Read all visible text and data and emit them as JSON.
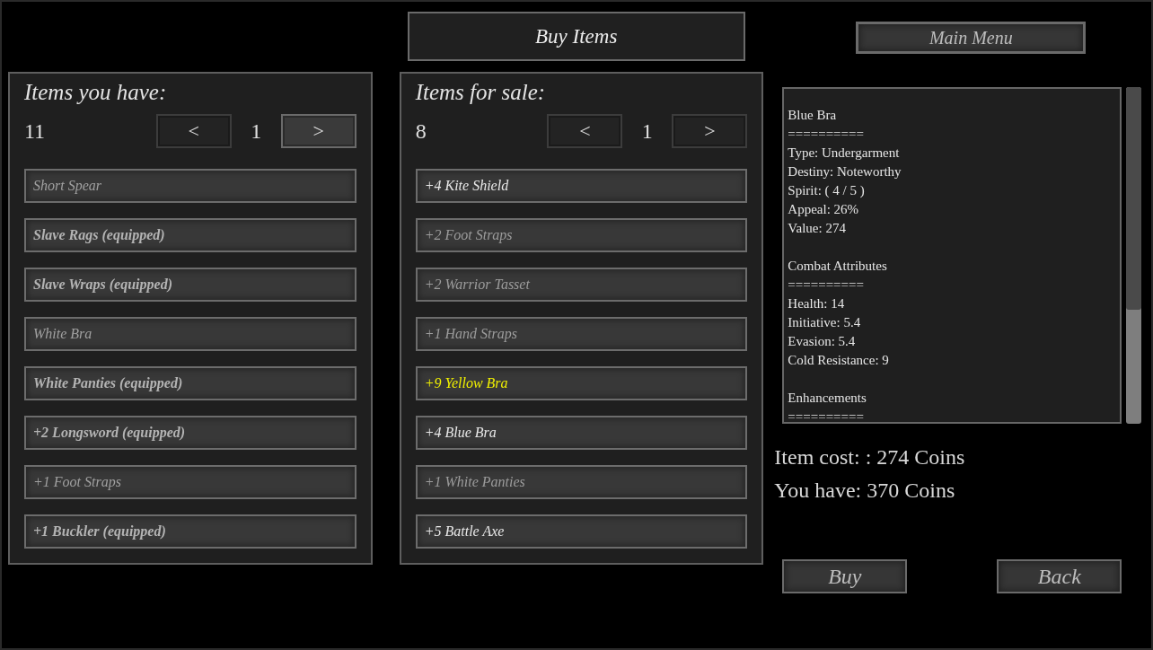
{
  "title": "Buy Items",
  "main_menu": "Main Menu",
  "inventory": {
    "heading": "Items you have:",
    "count": "11",
    "page": "1",
    "prev": {
      "label": "<",
      "enabled": false
    },
    "next": {
      "label": ">",
      "enabled": true
    },
    "items": [
      {
        "label": "Short Spear",
        "equipped": false,
        "color": "#a0a0a0"
      },
      {
        "label": "Slave Rags (equipped)",
        "equipped": true,
        "color": "#b4b4b4"
      },
      {
        "label": "Slave Wraps (equipped)",
        "equipped": true,
        "color": "#b4b4b4"
      },
      {
        "label": "White Bra",
        "equipped": false,
        "color": "#a0a0a0"
      },
      {
        "label": "White Panties (equipped)",
        "equipped": true,
        "color": "#b4b4b4"
      },
      {
        "label": "+2 Longsword (equipped)",
        "equipped": true,
        "color": "#b4b4b4"
      },
      {
        "label": "+1 Foot Straps",
        "equipped": false,
        "color": "#a0a0a0"
      },
      {
        "label": "+1 Buckler (equipped)",
        "equipped": true,
        "color": "#b4b4b4"
      }
    ]
  },
  "shop": {
    "heading": "Items for sale:",
    "count": "8",
    "page": "1",
    "prev": {
      "label": "<",
      "enabled": false
    },
    "next": {
      "label": ">",
      "enabled": false
    },
    "items": [
      {
        "label": "+4 Kite Shield",
        "equipped": false,
        "color": "#e8e8e8"
      },
      {
        "label": "+2 Foot Straps",
        "equipped": false,
        "color": "#9c9c9c"
      },
      {
        "label": "+2 Warrior Tasset",
        "equipped": false,
        "color": "#9c9c9c"
      },
      {
        "label": "+1 Hand Straps",
        "equipped": false,
        "color": "#9c9c9c"
      },
      {
        "label": "+9 Yellow Bra",
        "equipped": false,
        "color": "#f0f000"
      },
      {
        "label": "+4 Blue Bra",
        "equipped": false,
        "color": "#e8e8e8"
      },
      {
        "label": "+1 White Panties",
        "equipped": false,
        "color": "#9c9c9c"
      },
      {
        "label": "+5 Battle Axe",
        "equipped": false,
        "color": "#e8e8e8"
      }
    ]
  },
  "details": {
    "sections": [
      {
        "lines": [
          "Blue Bra",
          "==========",
          "Type: Undergarment",
          "Destiny: Noteworthy",
          "Spirit: ( 4 / 5 )",
          "Appeal: 26%",
          "Value: 274"
        ]
      },
      {
        "lines": [
          "Combat Attributes",
          "==========",
          "Health: 14",
          "Initiative: 5.4",
          "Evasion: 5.4",
          "Cold Resistance: 9"
        ]
      },
      {
        "lines": [
          "Enhancements",
          "=========="
        ]
      }
    ]
  },
  "cost": "Item cost: : 274 Coins",
  "funds": "You have: 370 Coins",
  "actions": [
    "Buy",
    "Back"
  ]
}
